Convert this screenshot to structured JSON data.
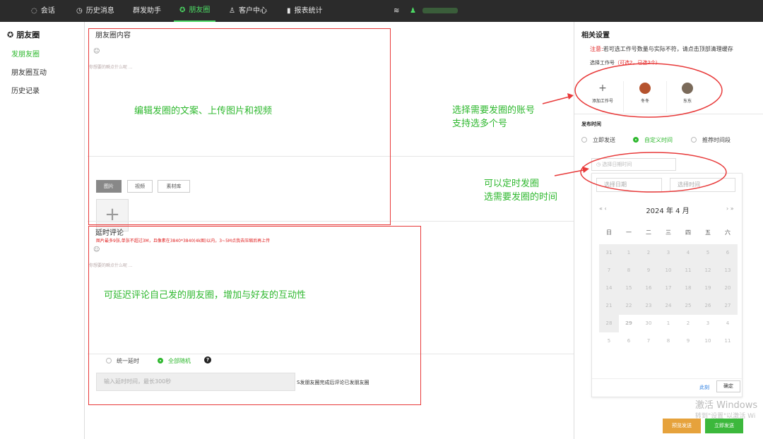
{
  "nav": {
    "items": [
      {
        "icon": "chat-icon",
        "glyph": "◌",
        "label": "会话"
      },
      {
        "icon": "clock-icon",
        "glyph": "◷",
        "label": "历史消息"
      },
      {
        "icon": "",
        "glyph": "",
        "label": "群发助手"
      },
      {
        "icon": "moments-icon",
        "glyph": "✪",
        "label": "朋友圈"
      },
      {
        "icon": "user-icon",
        "glyph": "♙",
        "label": "客户中心"
      },
      {
        "icon": "bar-chart-icon",
        "glyph": "▮",
        "label": "报表统计"
      }
    ],
    "db_glyph": "≋",
    "user_glyph": "♟"
  },
  "sidebar": {
    "title": "朋友圈",
    "title_glyph": "✪",
    "items": [
      "发朋友圈",
      "朋友圈互动",
      "历史记录"
    ]
  },
  "post": {
    "title": "朋友圈内容",
    "emoji_glyph": "☺",
    "placeholder": "你想要的瞬点什么呢 ...",
    "tabs": [
      "图片",
      "视频",
      "素材库"
    ],
    "upload_glyph": "+",
    "hint": "图片最多9张,单张不超过3M，且像素在3840*3840(4k图)以内，3~5M点我去压缩后再上传"
  },
  "comment": {
    "title": "延时评论",
    "emoji_glyph": "☺",
    "placeholder": "你想要的瞬点什么呢 ...",
    "delay_options": [
      "统一延时",
      "全部随机"
    ],
    "help_glyph": "?",
    "delay_placeholder": "输入延时时间，最长300秒",
    "delay_suffix": "S发朋友圈完成后评论已发朋友圈"
  },
  "annotations": {
    "content": "编辑发圈的文案、上传图片和视频",
    "account": [
      "选择需要发圈的账号",
      "支持选多个号"
    ],
    "comment": "可延迟评论自己发的朋友圈，增加与好友的互动性",
    "timing": [
      "可以定时发圈",
      "选需要发圈的时间"
    ]
  },
  "settings": {
    "title": "相关设置",
    "notice_prefix": "注意:",
    "notice_text": "若可选工作号数量与实际不符，请点击顶部清理缓存",
    "select_label": "选择工作号",
    "select_count": "（可选2，已选2个）",
    "accounts": [
      {
        "name": "添加工作号",
        "glyph": "+"
      },
      {
        "name": "冬冬",
        "color": "#b5532e"
      },
      {
        "name": "东东",
        "color": "#7a6a5a"
      }
    ],
    "publish_time_title": "发布时间",
    "publish_options": [
      "立即发送",
      "自定义时间",
      "推荐时间段"
    ],
    "date_placeholder": "◷ 选择日期时间",
    "cal_date_placeholder": "选择日期",
    "cal_time_placeholder": "选择时间",
    "cal_year_month": "2024 年  4 月",
    "cal_prev": "« ‹",
    "cal_next": "› »",
    "weekdays": [
      "日",
      "一",
      "二",
      "三",
      "四",
      "五",
      "六"
    ],
    "days": [
      [
        "31",
        "1",
        "2",
        "3",
        "4",
        "5",
        "6"
      ],
      [
        "7",
        "8",
        "9",
        "10",
        "11",
        "12",
        "13"
      ],
      [
        "14",
        "15",
        "16",
        "17",
        "18",
        "19",
        "20"
      ],
      [
        "21",
        "22",
        "23",
        "24",
        "25",
        "26",
        "27"
      ],
      [
        "28",
        "29",
        "30",
        "1",
        "2",
        "3",
        "4"
      ],
      [
        "5",
        "6",
        "7",
        "8",
        "9",
        "10",
        "11"
      ]
    ],
    "today": "29",
    "now_link": "此刻",
    "ok_button": "确定"
  },
  "footer": {
    "watermark_line1": "激活 Windows",
    "watermark_line2": "转到\"设置\"以激活 Wi",
    "preview_button": "预览发送",
    "publish_button": "立即发送"
  }
}
